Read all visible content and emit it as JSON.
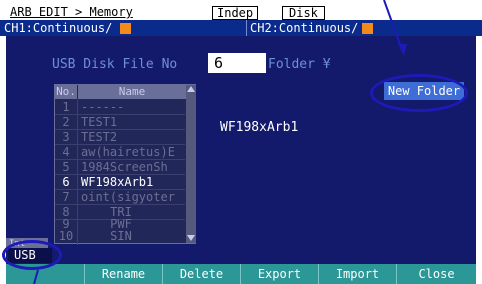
{
  "header": {
    "title": "ARB EDIT > Memory",
    "indep_label": "Indep",
    "disk_label": "Disk",
    "ch1_label": "CH1:Continuous/",
    "ch2_label": "CH2:Continuous/"
  },
  "colors": {
    "header_bar": "#0a2a8c",
    "panel": "#13196b",
    "channel_swatch": "#f28a1c",
    "softkey": "#2b9797",
    "annotation": "#1d1ab8",
    "new_folder_button": "#3e6dd8"
  },
  "file_panel": {
    "file_no_label": "USB Disk File No",
    "file_no_value": "6",
    "folder_label": "Folder ¥",
    "new_folder_button": "New Folder",
    "columns": [
      "No.",
      "Name"
    ],
    "rows": [
      {
        "no": "1",
        "name": "------"
      },
      {
        "no": "2",
        "name": "TEST1"
      },
      {
        "no": "3",
        "name": "TEST2"
      },
      {
        "no": "4",
        "name": "aw(hairetus)E"
      },
      {
        "no": "5",
        "name": "1984ScreenSh"
      },
      {
        "no": "6",
        "name": "WF198xArb1"
      },
      {
        "no": "7",
        "name": "oint(sigyoter"
      },
      {
        "no": "8",
        "name": "TRI"
      },
      {
        "no": "9",
        "name": "PWF"
      },
      {
        "no": "10",
        "name": "SIN"
      }
    ],
    "selected_row": 5,
    "preview_name": "WF198xArb1"
  },
  "storage": {
    "tab_label": "Int",
    "current": "USB"
  },
  "softkeys": [
    "Rename",
    "Delete",
    "Export",
    "Import",
    "Close"
  ]
}
